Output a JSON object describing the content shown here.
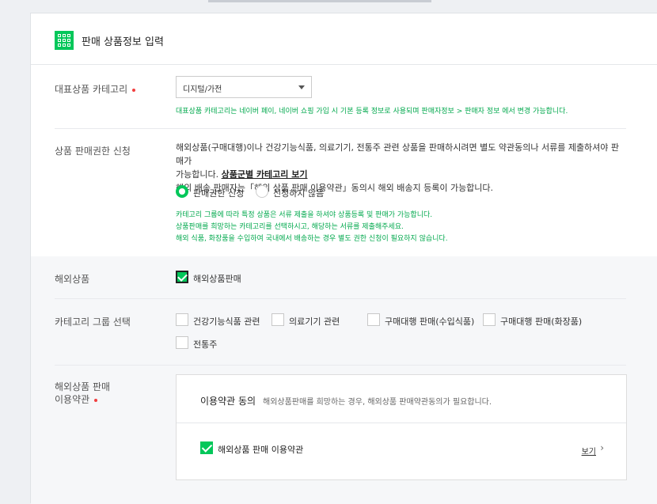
{
  "header": {
    "title": "판매 상품정보 입력",
    "icon": "grid-icon"
  },
  "category": {
    "label": "대표상품 카테고리",
    "select_value": "디지털/가전",
    "note": "대표상품 카테고리는 네이버 페이, 네이버 쇼핑 가입 시 기본 등록 정보로 사용되며 판매자정보 > 판매자 정보 에서 변경 가능합니다."
  },
  "permission": {
    "label": "상품 판매권한 신청",
    "desc_line1": "해외상품(구매대행)이나 건강기능식품, 의료기기, 전통주 관련 상품을 판매하시려면 별도 약관동의나 서류를 제출하셔야 판매가",
    "desc_line2_prefix": "가능합니다.",
    "desc_link": "상품군별 카테고리 보기",
    "desc_line3": "해외 배송 판매자는「해외 상품 판매 이용약관」동의시 해외 배송지 등록이 가능합니다.",
    "radio_on": "판매권한 신청",
    "radio_off": "신청하지 않음",
    "note1": "카테고리 그룹에 따라 특정 상품은 서류 제출을 하셔야 상품등록 및 판매가 가능합니다.",
    "note2": "상품판매를 희망하는 카테고리를 선택하시고, 해당하는 서류를 제출해주세요.",
    "note3": "해외 식품, 화장품을 수입하여 국내에서 배송하는 경우 별도 권한 신청이 필요하지 않습니다."
  },
  "overseas": {
    "label": "해외상품",
    "checkbox_label": "해외상품판매"
  },
  "group": {
    "label": "카테고리 그룹 선택",
    "options": [
      "건강기능식품 관련",
      "의료기기 관련",
      "구매대행 판매(수입식품)",
      "구매대행 판매(화장품)",
      "전통주"
    ]
  },
  "terms": {
    "label_line1": "해외상품 판매",
    "label_line2": "이용약관",
    "title": "이용약관 동의",
    "subtitle": "해외상품판매를 희망하는 경우, 해외상품 판매약관동의가 필요합니다.",
    "item": "해외상품 판매 이용약관",
    "view": "보기"
  },
  "colors": {
    "accent": "#03c75a",
    "required": "#f13f3f",
    "note": "#03a94e"
  }
}
